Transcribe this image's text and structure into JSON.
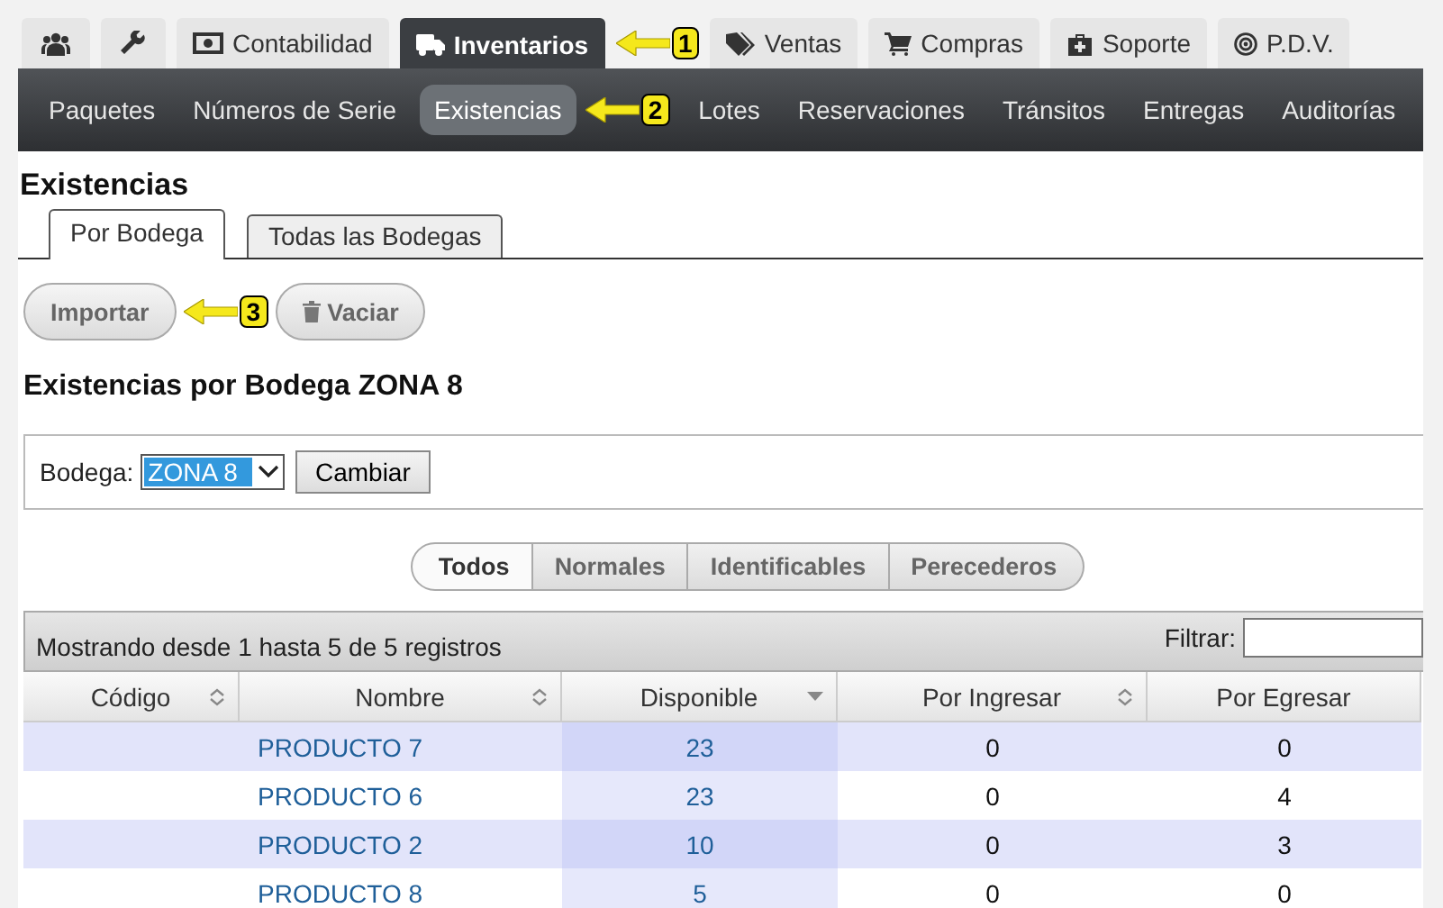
{
  "main_tabs": [
    {
      "selected": false
    },
    {
      "selected": false
    },
    {
      "label": "Contabilidad",
      "selected": false
    },
    {
      "label": "Inventarios",
      "selected": true
    },
    {
      "label": "Ventas",
      "selected": false
    },
    {
      "label": "Compras",
      "selected": false
    },
    {
      "label": "Soporte",
      "selected": false
    },
    {
      "label": "P.D.V.",
      "selected": false
    }
  ],
  "sub_nav": [
    {
      "label": "Paquetes",
      "selected": false
    },
    {
      "label": "Números de Serie",
      "selected": false
    },
    {
      "label": "Existencias",
      "selected": true
    },
    {
      "label": "Lotes",
      "selected": false
    },
    {
      "label": "Reservaciones",
      "selected": false
    },
    {
      "label": "Tránsitos",
      "selected": false
    },
    {
      "label": "Entregas",
      "selected": false
    },
    {
      "label": "Auditorías",
      "selected": false
    }
  ],
  "page_title": "Existencias",
  "view_tabs": [
    {
      "label": "Por Bodega",
      "selected": true
    },
    {
      "label": "Todas las Bodegas",
      "selected": false
    }
  ],
  "actions": [
    {
      "label": "Importar",
      "kind": "plain"
    },
    {
      "label": "Vaciar",
      "kind": "trash"
    }
  ],
  "section_title": "Existencias por Bodega ZONA 8",
  "bodega": {
    "label": "Bodega:",
    "value": "ZONA 8",
    "button": "Cambiar"
  },
  "filters": [
    {
      "label": "Todos",
      "selected": true
    },
    {
      "label": "Normales",
      "selected": false
    },
    {
      "label": "Identificables",
      "selected": false
    },
    {
      "label": "Perecederos",
      "selected": false
    }
  ],
  "table": {
    "info": "Mostrando desde 1 hasta 5 de 5 registros",
    "filter_label": "Filtrar:",
    "columns": [
      {
        "label": "Código",
        "sorted": false
      },
      {
        "label": "Nombre",
        "sorted": false
      },
      {
        "label": "Disponible",
        "sorted": true
      },
      {
        "label": "Por Ingresar",
        "sorted": false
      },
      {
        "label": "Por Egresar",
        "sorted": false
      }
    ],
    "rows": [
      {
        "nombre": "PRODUCTO 7",
        "disponible": "23",
        "por_ingresar": "0",
        "por_egresar": "0"
      },
      {
        "nombre": "PRODUCTO 6",
        "disponible": "23",
        "por_ingresar": "0",
        "por_egresar": "4"
      },
      {
        "nombre": "PRODUCTO 2",
        "disponible": "10",
        "por_ingresar": "0",
        "por_egresar": "3"
      },
      {
        "nombre": "PRODUCTO 8",
        "disponible": "5",
        "por_ingresar": "0",
        "por_egresar": "0"
      }
    ]
  },
  "annotations": [
    {
      "number": "1"
    },
    {
      "number": "2"
    },
    {
      "number": "3"
    }
  ]
}
